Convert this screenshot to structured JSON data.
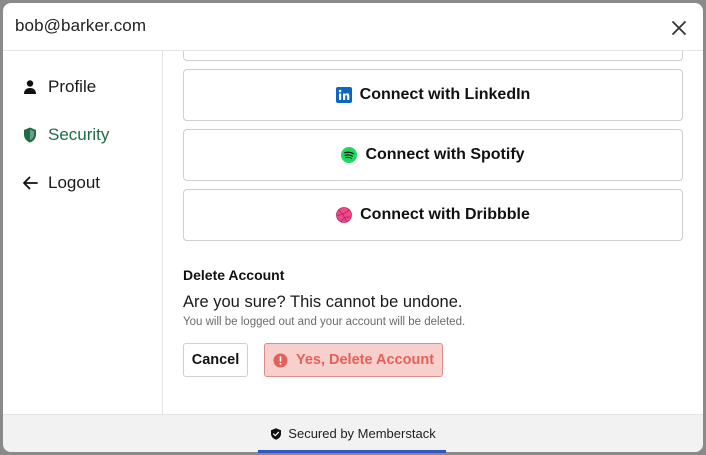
{
  "header": {
    "email": "bob@barker.com"
  },
  "sidebar": {
    "items": [
      {
        "label": "Profile",
        "icon": "person-icon"
      },
      {
        "label": "Security",
        "icon": "shield-icon",
        "active": true
      },
      {
        "label": "Logout",
        "icon": "arrow-left-icon"
      }
    ]
  },
  "connections": [
    {
      "label": "Connect with LinkedIn",
      "icon": "linkedin-icon",
      "color": "#0a66c2"
    },
    {
      "label": "Connect with Spotify",
      "icon": "spotify-icon",
      "color": "#1ed760"
    },
    {
      "label": "Connect with Dribbble",
      "icon": "dribbble-icon",
      "color": "#ea4c89"
    }
  ],
  "delete_account": {
    "title": "Delete Account",
    "question": "Are you sure? This cannot be undone.",
    "note": "You will be logged out and your account will be deleted.",
    "cancel_label": "Cancel",
    "confirm_label": "Yes, Delete Account"
  },
  "footer": {
    "text": "Secured by Memberstack"
  },
  "colors": {
    "accent": "#1f6b48",
    "danger": "#e2625a",
    "danger_bg": "#f7cfcc"
  }
}
